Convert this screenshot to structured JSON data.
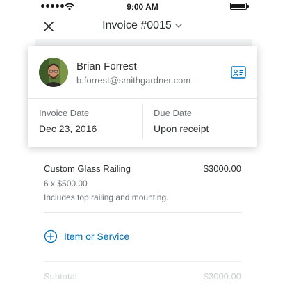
{
  "status_bar": {
    "time": "9:00 AM",
    "signal_icon": "signal-dots-icon",
    "wifi_icon": "wifi-icon",
    "battery_icon": "battery-icon",
    "battery_level": 1.0
  },
  "nav": {
    "title": "Invoice #0015",
    "close_icon": "close-icon",
    "dropdown_icon": "chevron-down-icon"
  },
  "customer": {
    "name": "Brian Forrest",
    "email": "b.forrest@smithgardner.com",
    "contact_icon": "contact-card-icon"
  },
  "dates": {
    "invoice_date_label": "Invoice Date",
    "invoice_date_value": "Dec 23, 2016",
    "due_date_label": "Due Date",
    "due_date_value": "Upon receipt"
  },
  "line_items": [
    {
      "name": "Custom Glass Railing",
      "price": "$3000.00",
      "quantity": "6 x $500.00",
      "description": "Includes top railing and mounting."
    }
  ],
  "add_item": {
    "label": "Item or Service",
    "icon": "plus-circle-icon"
  },
  "summary": {
    "subtotal_label": "Subtotal",
    "subtotal_value": "$3000.00"
  },
  "colors": {
    "accent": "#0070ba",
    "text_primary": "#2c2e2f",
    "text_secondary": "#6c7378",
    "divider": "#e4e6e8"
  }
}
